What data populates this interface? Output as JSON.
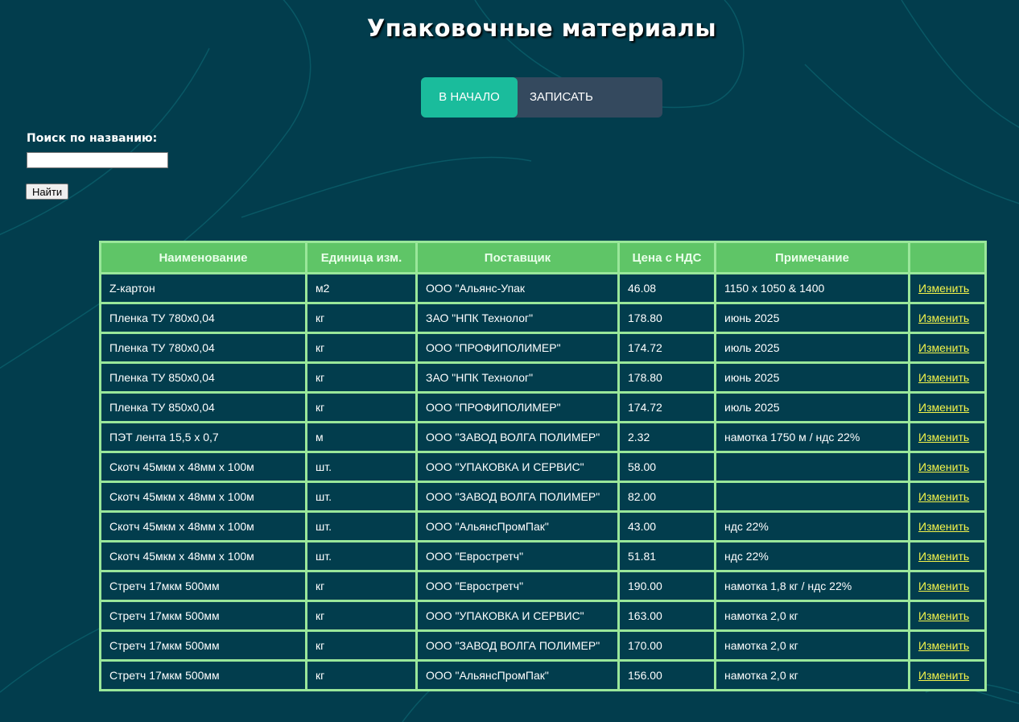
{
  "page": {
    "title": "Упаковочные материалы"
  },
  "nav": {
    "home_label": "В НАЧАЛО",
    "record_label": "ЗАПИСАТЬ"
  },
  "search": {
    "label": "Поиск по названию:",
    "value": "",
    "button_label": "Найти"
  },
  "table": {
    "headers": [
      "Наименование",
      "Единица изм.",
      "Поставщик",
      "Цена с НДС",
      "Примечание",
      ""
    ],
    "rows": [
      {
        "name": "Z-картон",
        "unit": "м2",
        "supplier": "ООО \"Альянс-Упак",
        "price": "46.08",
        "note": "1150 х 1050 & 1400",
        "action": "Изменить"
      },
      {
        "name": "Пленка ТУ 780х0,04",
        "unit": "кг",
        "supplier": "ЗАО \"НПК Технолог\"",
        "price": "178.80",
        "note": "июнь 2025",
        "action": "Изменить"
      },
      {
        "name": "Пленка ТУ 780х0,04",
        "unit": "кг",
        "supplier": "ООО \"ПРОФИПОЛИМЕР\"",
        "price": "174.72",
        "note": "июль 2025",
        "action": "Изменить"
      },
      {
        "name": "Пленка ТУ 850х0,04",
        "unit": "кг",
        "supplier": "ЗАО \"НПК Технолог\"",
        "price": "178.80",
        "note": "июнь 2025",
        "action": "Изменить"
      },
      {
        "name": "Пленка ТУ 850х0,04",
        "unit": "кг",
        "supplier": "ООО \"ПРОФИПОЛИМЕР\"",
        "price": "174.72",
        "note": "июль 2025",
        "action": "Изменить"
      },
      {
        "name": "ПЭТ лента 15,5 х 0,7",
        "unit": "м",
        "supplier": "ООО \"ЗАВОД ВОЛГА ПОЛИМЕР\"",
        "price": "2.32",
        "note": "намотка 1750 м / ндс 22%",
        "action": "Изменить"
      },
      {
        "name": "Скотч 45мкм х 48мм х 100м",
        "unit": "шт.",
        "supplier": "ООО \"УПАКОВКА И СЕРВИС\"",
        "price": "58.00",
        "note": "",
        "action": "Изменить"
      },
      {
        "name": "Скотч 45мкм х 48мм х 100м",
        "unit": "шт.",
        "supplier": "ООО \"ЗАВОД ВОЛГА ПОЛИМЕР\"",
        "price": "82.00",
        "note": "",
        "action": "Изменить"
      },
      {
        "name": "Скотч 45мкм х 48мм х 100м",
        "unit": "шт.",
        "supplier": "ООО \"АльянсПромПак\"",
        "price": "43.00",
        "note": "ндс 22%",
        "action": "Изменить"
      },
      {
        "name": "Скотч 45мкм х 48мм х 100м",
        "unit": "шт.",
        "supplier": "ООО \"Евростретч\"",
        "price": "51.81",
        "note": "ндс 22%",
        "action": "Изменить"
      },
      {
        "name": "Стретч 17мкм 500мм",
        "unit": "кг",
        "supplier": "ООО \"Евростретч\"",
        "price": "190.00",
        "note": "намотка 1,8 кг / ндс 22%",
        "action": "Изменить"
      },
      {
        "name": "Стретч 17мкм 500мм",
        "unit": "кг",
        "supplier": "ООО \"УПАКОВКА И СЕРВИС\"",
        "price": "163.00",
        "note": "намотка 2,0 кг",
        "action": "Изменить"
      },
      {
        "name": "Стретч 17мкм 500мм",
        "unit": "кг",
        "supplier": "ООО \"ЗАВОД ВОЛГА ПОЛИМЕР\"",
        "price": "170.00",
        "note": "намотка 2,0 кг",
        "action": "Изменить"
      },
      {
        "name": "Стретч 17мкм 500мм",
        "unit": "кг",
        "supplier": "ООО \"АльянсПромПак\"",
        "price": "156.00",
        "note": "намотка 2,0 кг",
        "action": "Изменить"
      }
    ]
  },
  "colors": {
    "background": "#023d4d",
    "header_green": "#5fc567",
    "border_green": "#9ae79a",
    "link_yellow": "#f4f44a",
    "nav_active": "#1abc9c",
    "nav_bg": "#34495e"
  }
}
